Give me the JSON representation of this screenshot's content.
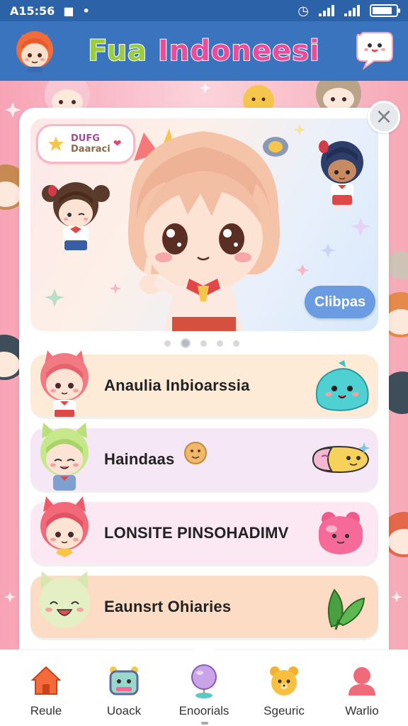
{
  "status_bar": {
    "time": "A15:56",
    "battery_level": 0.85
  },
  "header": {
    "title_part1": "Fua",
    "title_part2": "Indoneesi"
  },
  "banner": {
    "badge_line1": "DUFG",
    "badge_line2": "Daaraci",
    "button_label": "Clibpas",
    "slides_total": 5,
    "active_slide": 2
  },
  "list": {
    "items": [
      {
        "label": "Anaulia Inbioarssia",
        "bg": "#fdebd8"
      },
      {
        "label": "Haindaas",
        "bg": "#f5e7f6"
      },
      {
        "label": "LONSITE PINSOHADIMV",
        "bg": "#fbe8f2"
      },
      {
        "label": "Eaunsrt Ohiaries",
        "bg": "#fcdcc5"
      }
    ]
  },
  "bottom_nav": {
    "items": [
      {
        "label": "Reule",
        "icon": "home-icon"
      },
      {
        "label": "Uoack",
        "icon": "robot-icon"
      },
      {
        "label": "Enoorials",
        "icon": "balloon-icon"
      },
      {
        "label": "Sgeuric",
        "icon": "bear-icon"
      },
      {
        "label": "Warlio",
        "icon": "profile-icon"
      }
    ]
  },
  "colors": {
    "header": "#3b74be",
    "status_bar": "#2b62a8",
    "accent_pink": "#ec4d9a",
    "accent_green": "#9ccc3a",
    "button_blue": "#6b9be0"
  }
}
